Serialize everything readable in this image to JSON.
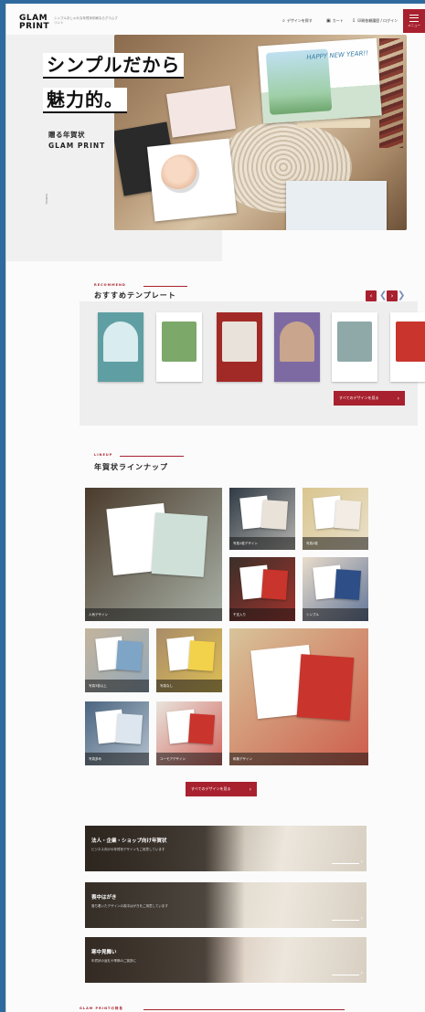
{
  "header": {
    "logo_line1": "GLAM",
    "logo_line2": "PRINT",
    "logo_sub": "シンプルおしゃれな年賀状印刷ならグラムプリント",
    "nav": [
      {
        "label": "デザインを探す",
        "icon": "search-icon"
      },
      {
        "label": "カート",
        "icon": "cart-icon"
      },
      {
        "label": "印刷依頼履歴 / ログイン",
        "icon": "user-icon"
      }
    ],
    "menu_label": "メニュー"
  },
  "hero": {
    "title_line1": "シンプルだから",
    "title_line2": "魅力的。",
    "tag_line1": "贈る年賀状",
    "tag_line2": "GLAM PRINT",
    "card_text": "HAPPY NEW YEAR!!",
    "scroll_label": "SCROLL"
  },
  "recommend": {
    "en": "RECOMMEND",
    "title": "おすすめテンプレート",
    "prev": "‹",
    "next": "›",
    "cta": "すべてのデザインを見る",
    "items": [
      {
        "bg": "#5f9fa3",
        "inner": "#d9ecef"
      },
      {
        "bg": "#ffffff",
        "inner": "#7ca86a"
      },
      {
        "bg": "#a22a26",
        "inner": "#e9e2da"
      },
      {
        "bg": "#7d6aa3",
        "inner": "#c8a58c"
      },
      {
        "bg": "#ffffff",
        "inner": "#8fa9a9"
      },
      {
        "bg": "#ffffff",
        "inner": "#c9342c"
      }
    ]
  },
  "lineup": {
    "en": "LINEUP",
    "title": "年賀状ラインナップ",
    "cta": "すべてのデザインを見る",
    "tiles": [
      {
        "caption": "人気デザイン",
        "bg": "#4a3b2c",
        "accent": "#cfe0d8"
      },
      {
        "caption": "写真1枚デザイン",
        "bg": "#2f3a44",
        "accent": "#e8e2d8"
      },
      {
        "caption": "写真2枚",
        "bg": "#d9c58f",
        "accent": "#f2ece4"
      },
      {
        "caption": "干支入り",
        "bg": "#3a2f2a",
        "accent": "#c9342c"
      },
      {
        "caption": "シンプル",
        "bg": "#e9dccb",
        "accent": "#2d4e86"
      },
      {
        "caption": "写真3枚以上",
        "bg": "#c4b49c",
        "accent": "#7ea4c6"
      },
      {
        "caption": "写真なし",
        "bg": "#a98c6a",
        "accent": "#f2d24a"
      },
      {
        "caption": "和風デザイン",
        "bg": "#d8c49a",
        "accent": "#c9342c"
      },
      {
        "caption": "写真多め",
        "bg": "#4b6580",
        "accent": "#dde6ee"
      },
      {
        "caption": "ユーモアデザイン",
        "bg": "#e8e4dc",
        "accent": "#c9342c"
      }
    ]
  },
  "banners": [
    {
      "title": "法人・企業・ショップ向け年賀状",
      "sub": "ビジネス向けの年賀状デザインもご用意しています",
      "bg": "#6a5640"
    },
    {
      "title": "喪中はがき",
      "sub": "落ち着いたデザインの喪中はがきをご用意しています",
      "bg": "#c7bba8"
    },
    {
      "title": "寒中見舞い",
      "sub": "年賀状の返礼や季節のご挨拶に",
      "bg": "#b58f7a"
    }
  ],
  "footer_heading": "GLAM PRINTの特長"
}
